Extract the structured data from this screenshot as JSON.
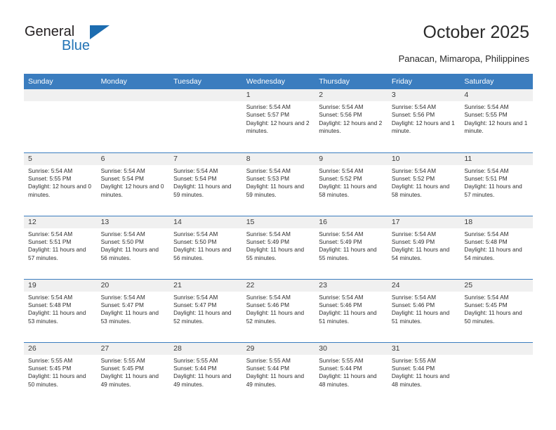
{
  "brand": {
    "name_part1": "General",
    "name_part2": "Blue",
    "accent_color": "#2273b5",
    "triangle_icon": "triangle-icon"
  },
  "header": {
    "title": "October 2025",
    "location": "Panacan, Mimaropa, Philippines"
  },
  "calendar": {
    "weekday_headers": [
      "Sunday",
      "Monday",
      "Tuesday",
      "Wednesday",
      "Thursday",
      "Friday",
      "Saturday"
    ],
    "header_bg": "#3b7dbf",
    "daynum_bg": "#f0f0f0",
    "weeks": [
      [
        {
          "day": "",
          "empty": true
        },
        {
          "day": "",
          "empty": true
        },
        {
          "day": "",
          "empty": true
        },
        {
          "day": "1",
          "sunrise": "Sunrise: 5:54 AM",
          "sunset": "Sunset: 5:57 PM",
          "daylight": "Daylight: 12 hours and 2 minutes."
        },
        {
          "day": "2",
          "sunrise": "Sunrise: 5:54 AM",
          "sunset": "Sunset: 5:56 PM",
          "daylight": "Daylight: 12 hours and 2 minutes."
        },
        {
          "day": "3",
          "sunrise": "Sunrise: 5:54 AM",
          "sunset": "Sunset: 5:56 PM",
          "daylight": "Daylight: 12 hours and 1 minute."
        },
        {
          "day": "4",
          "sunrise": "Sunrise: 5:54 AM",
          "sunset": "Sunset: 5:55 PM",
          "daylight": "Daylight: 12 hours and 1 minute."
        }
      ],
      [
        {
          "day": "5",
          "sunrise": "Sunrise: 5:54 AM",
          "sunset": "Sunset: 5:55 PM",
          "daylight": "Daylight: 12 hours and 0 minutes."
        },
        {
          "day": "6",
          "sunrise": "Sunrise: 5:54 AM",
          "sunset": "Sunset: 5:54 PM",
          "daylight": "Daylight: 12 hours and 0 minutes."
        },
        {
          "day": "7",
          "sunrise": "Sunrise: 5:54 AM",
          "sunset": "Sunset: 5:54 PM",
          "daylight": "Daylight: 11 hours and 59 minutes."
        },
        {
          "day": "8",
          "sunrise": "Sunrise: 5:54 AM",
          "sunset": "Sunset: 5:53 PM",
          "daylight": "Daylight: 11 hours and 59 minutes."
        },
        {
          "day": "9",
          "sunrise": "Sunrise: 5:54 AM",
          "sunset": "Sunset: 5:52 PM",
          "daylight": "Daylight: 11 hours and 58 minutes."
        },
        {
          "day": "10",
          "sunrise": "Sunrise: 5:54 AM",
          "sunset": "Sunset: 5:52 PM",
          "daylight": "Daylight: 11 hours and 58 minutes."
        },
        {
          "day": "11",
          "sunrise": "Sunrise: 5:54 AM",
          "sunset": "Sunset: 5:51 PM",
          "daylight": "Daylight: 11 hours and 57 minutes."
        }
      ],
      [
        {
          "day": "12",
          "sunrise": "Sunrise: 5:54 AM",
          "sunset": "Sunset: 5:51 PM",
          "daylight": "Daylight: 11 hours and 57 minutes."
        },
        {
          "day": "13",
          "sunrise": "Sunrise: 5:54 AM",
          "sunset": "Sunset: 5:50 PM",
          "daylight": "Daylight: 11 hours and 56 minutes."
        },
        {
          "day": "14",
          "sunrise": "Sunrise: 5:54 AM",
          "sunset": "Sunset: 5:50 PM",
          "daylight": "Daylight: 11 hours and 56 minutes."
        },
        {
          "day": "15",
          "sunrise": "Sunrise: 5:54 AM",
          "sunset": "Sunset: 5:49 PM",
          "daylight": "Daylight: 11 hours and 55 minutes."
        },
        {
          "day": "16",
          "sunrise": "Sunrise: 5:54 AM",
          "sunset": "Sunset: 5:49 PM",
          "daylight": "Daylight: 11 hours and 55 minutes."
        },
        {
          "day": "17",
          "sunrise": "Sunrise: 5:54 AM",
          "sunset": "Sunset: 5:49 PM",
          "daylight": "Daylight: 11 hours and 54 minutes."
        },
        {
          "day": "18",
          "sunrise": "Sunrise: 5:54 AM",
          "sunset": "Sunset: 5:48 PM",
          "daylight": "Daylight: 11 hours and 54 minutes."
        }
      ],
      [
        {
          "day": "19",
          "sunrise": "Sunrise: 5:54 AM",
          "sunset": "Sunset: 5:48 PM",
          "daylight": "Daylight: 11 hours and 53 minutes."
        },
        {
          "day": "20",
          "sunrise": "Sunrise: 5:54 AM",
          "sunset": "Sunset: 5:47 PM",
          "daylight": "Daylight: 11 hours and 53 minutes."
        },
        {
          "day": "21",
          "sunrise": "Sunrise: 5:54 AM",
          "sunset": "Sunset: 5:47 PM",
          "daylight": "Daylight: 11 hours and 52 minutes."
        },
        {
          "day": "22",
          "sunrise": "Sunrise: 5:54 AM",
          "sunset": "Sunset: 5:46 PM",
          "daylight": "Daylight: 11 hours and 52 minutes."
        },
        {
          "day": "23",
          "sunrise": "Sunrise: 5:54 AM",
          "sunset": "Sunset: 5:46 PM",
          "daylight": "Daylight: 11 hours and 51 minutes."
        },
        {
          "day": "24",
          "sunrise": "Sunrise: 5:54 AM",
          "sunset": "Sunset: 5:46 PM",
          "daylight": "Daylight: 11 hours and 51 minutes."
        },
        {
          "day": "25",
          "sunrise": "Sunrise: 5:54 AM",
          "sunset": "Sunset: 5:45 PM",
          "daylight": "Daylight: 11 hours and 50 minutes."
        }
      ],
      [
        {
          "day": "26",
          "sunrise": "Sunrise: 5:55 AM",
          "sunset": "Sunset: 5:45 PM",
          "daylight": "Daylight: 11 hours and 50 minutes."
        },
        {
          "day": "27",
          "sunrise": "Sunrise: 5:55 AM",
          "sunset": "Sunset: 5:45 PM",
          "daylight": "Daylight: 11 hours and 49 minutes."
        },
        {
          "day": "28",
          "sunrise": "Sunrise: 5:55 AM",
          "sunset": "Sunset: 5:44 PM",
          "daylight": "Daylight: 11 hours and 49 minutes."
        },
        {
          "day": "29",
          "sunrise": "Sunrise: 5:55 AM",
          "sunset": "Sunset: 5:44 PM",
          "daylight": "Daylight: 11 hours and 49 minutes."
        },
        {
          "day": "30",
          "sunrise": "Sunrise: 5:55 AM",
          "sunset": "Sunset: 5:44 PM",
          "daylight": "Daylight: 11 hours and 48 minutes."
        },
        {
          "day": "31",
          "sunrise": "Sunrise: 5:55 AM",
          "sunset": "Sunset: 5:44 PM",
          "daylight": "Daylight: 11 hours and 48 minutes."
        },
        {
          "day": "",
          "empty": true
        }
      ]
    ]
  }
}
